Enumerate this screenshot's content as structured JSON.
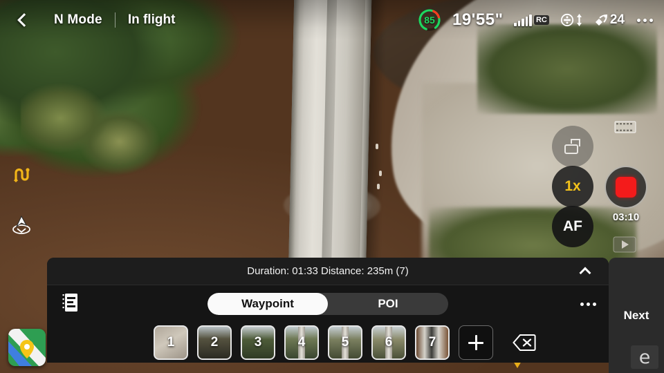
{
  "topbar": {
    "back_icon": "chevron-left-icon",
    "flight_mode": "N Mode",
    "flight_state": "In flight",
    "menu_icon": "kebab-menu-icon"
  },
  "status": {
    "battery_percent": "85",
    "battery_color": "#1ed760",
    "battery_warning_color": "#ff3b1f",
    "flight_time": "19'55\"",
    "signal_icon": "signal-bars-icon",
    "signal_bars": 5,
    "rc_label": "RC",
    "obstacle_icon": "obstacle-sensing-icon",
    "vertical_arrow_icon": "up-down-arrow-icon",
    "satellite_icon": "satellite-icon",
    "satellite_count": "24"
  },
  "left_rail": {
    "items": [
      {
        "icon": "waypoint-route-icon",
        "color": "#f0b419"
      },
      {
        "icon": "return-to-home-icon",
        "color": "#ffffff"
      }
    ]
  },
  "camera": {
    "mode_switch_icon": "camera-photo-video-switch-icon",
    "zoom_label": "1x",
    "zoom_color": "#f2c11b",
    "focus_label": "AF",
    "record_icon": "stop-record-square-icon",
    "record_color": "#f41b1b",
    "record_time": "03:10",
    "film_icon": "film-strip-icon",
    "playback_icon": "play-triangle-icon"
  },
  "waypoint_panel": {
    "summary": "Duration: 01:33 Distance: 235m (7)",
    "collapse_icon": "chevron-up-icon",
    "list_icon": "mission-list-icon",
    "menu_icon": "kebab-menu-icon",
    "tabs": [
      {
        "label": "Waypoint",
        "active": true
      },
      {
        "label": "POI",
        "active": false
      }
    ],
    "waypoints": [
      "1",
      "2",
      "3",
      "4",
      "5",
      "6",
      "7"
    ],
    "add_icon": "plus-icon",
    "delete_icon": "backspace-delete-icon"
  },
  "next_button": {
    "label": "Next"
  },
  "map_thumb": {
    "icon": "map-thumbnail-icon",
    "pin_color": "#f5c518"
  },
  "watermark": {
    "text": "e"
  }
}
